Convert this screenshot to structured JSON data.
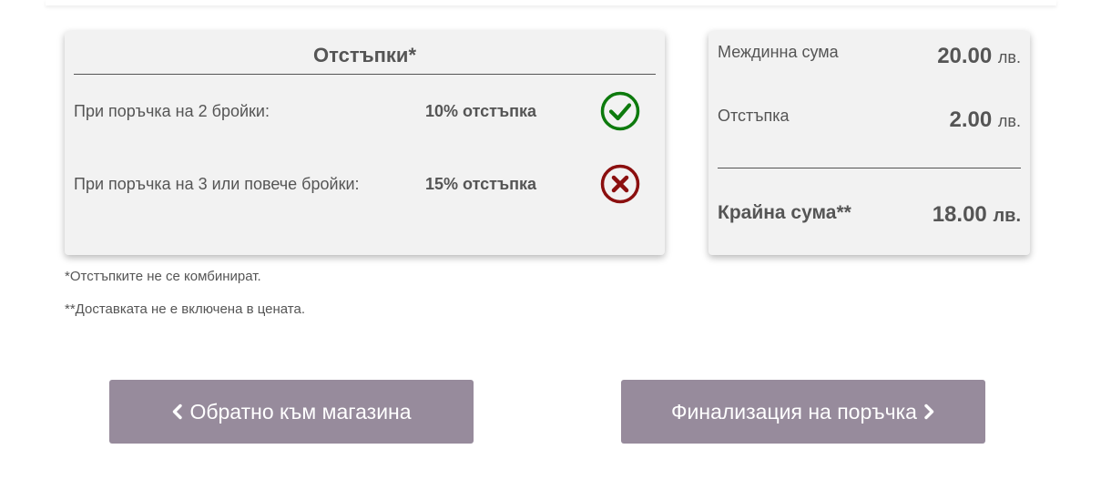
{
  "discounts": {
    "title": "Отстъпки*",
    "rows": [
      {
        "label": "При поръчка на 2 бройки:",
        "value": "10% отстъпка",
        "status": "check-icon",
        "status_color": "#0d7a0d"
      },
      {
        "label": "При поръчка на 3 или повече бройки:",
        "value": "15% отстъпка",
        "status": "x-icon",
        "status_color": "#8b0f0f"
      }
    ]
  },
  "totals": {
    "subtotal_label": "Междинна сума",
    "subtotal_amount": "20.00",
    "discount_label": "Отстъпка",
    "discount_amount": "2.00",
    "final_label": "Крайна сума**",
    "final_amount": "18.00",
    "currency": "лв."
  },
  "notes": {
    "note1": "*Отстъпките не се комбинират.",
    "note2": "**Доставката не е включена в цената."
  },
  "buttons": {
    "back_label": "Обратно към магазина",
    "finalize_label": "Финализация на поръчка",
    "color": "#978b9c"
  }
}
